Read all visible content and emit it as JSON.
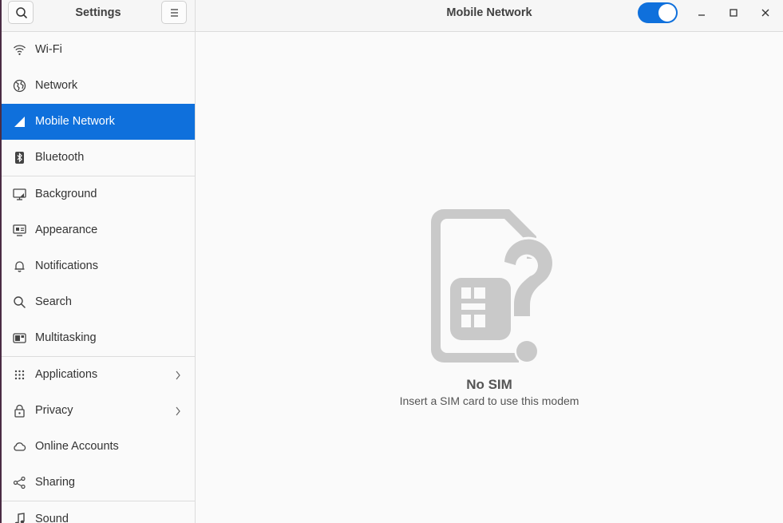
{
  "sidebar": {
    "title": "Settings",
    "items": [
      {
        "label": "Wi-Fi",
        "icon": "wifi-icon"
      },
      {
        "label": "Network",
        "icon": "globe-icon"
      },
      {
        "label": "Mobile Network",
        "icon": "signal-icon",
        "active": true
      },
      {
        "label": "Bluetooth",
        "icon": "bluetooth-icon"
      },
      {
        "label": "Background",
        "icon": "monitor-icon"
      },
      {
        "label": "Appearance",
        "icon": "appearance-icon"
      },
      {
        "label": "Notifications",
        "icon": "bell-icon"
      },
      {
        "label": "Search",
        "icon": "search-icon"
      },
      {
        "label": "Multitasking",
        "icon": "multitasking-icon"
      },
      {
        "label": "Applications",
        "icon": "grid-icon"
      },
      {
        "label": "Privacy",
        "icon": "lock-icon"
      },
      {
        "label": "Online Accounts",
        "icon": "cloud-icon"
      },
      {
        "label": "Sharing",
        "icon": "share-icon"
      },
      {
        "label": "Sound",
        "icon": "music-note-icon"
      }
    ]
  },
  "header": {
    "title": "Mobile Network",
    "toggle_on": true
  },
  "empty_state": {
    "title": "No SIM",
    "description": "Insert a SIM card to use this modem"
  },
  "colors": {
    "accent": "#0f70dc",
    "illustration": "#c9c9c9"
  }
}
